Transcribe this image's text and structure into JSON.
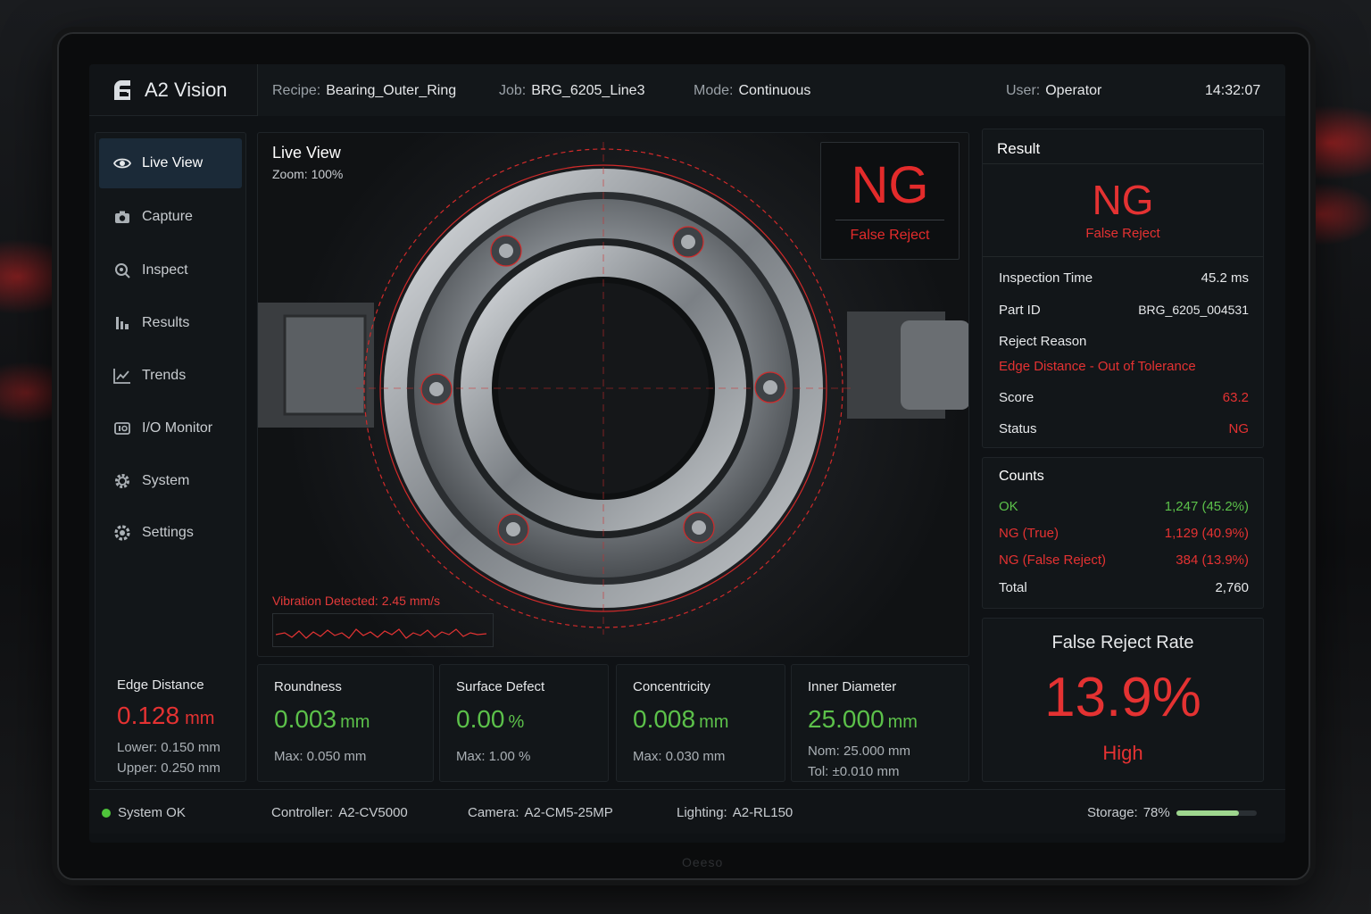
{
  "app": {
    "name": "A2 Vision",
    "bezel_brand": "Oeeso"
  },
  "header": {
    "recipe": {
      "label": "Recipe:",
      "value": "Bearing_Outer_Ring"
    },
    "job": {
      "label": "Job:",
      "value": "BRG_6205_Line3"
    },
    "mode": {
      "label": "Mode:",
      "value": "Continuous"
    },
    "user": {
      "label": "User:",
      "value": "Operator"
    },
    "time": "14:32:07"
  },
  "sidebar": {
    "items": [
      {
        "label": "Live View",
        "icon": "eye-icon",
        "active": true
      },
      {
        "label": "Capture",
        "icon": "camera-icon"
      },
      {
        "label": "Inspect",
        "icon": "magnifier-icon"
      },
      {
        "label": "Results",
        "icon": "results-icon"
      },
      {
        "label": "Trends",
        "icon": "trend-icon"
      },
      {
        "label": "I/O Monitor",
        "icon": "io-icon"
      },
      {
        "label": "System",
        "icon": "system-gear-icon"
      },
      {
        "label": "Settings",
        "icon": "settings-gear-icon"
      }
    ]
  },
  "live_view": {
    "title": "Live View",
    "zoom": "Zoom: 100%",
    "result": "NG",
    "result_sub": "False Reject",
    "vibration": "Vibration Detected: 2.45 mm/s"
  },
  "metrics": {
    "edge_distance": {
      "title": "Edge Distance",
      "value": "0.128",
      "unit": "mm",
      "sub1": "Lower: 0.150 mm",
      "sub2": "Upper: 0.250 mm"
    },
    "roundness": {
      "title": "Roundness",
      "value": "0.003",
      "unit": "mm",
      "sub1": "Max: 0.050 mm"
    },
    "surface_defect": {
      "title": "Surface Defect",
      "value": "0.00",
      "unit": "%",
      "sub1": "Max: 1.00 %"
    },
    "concentricity": {
      "title": "Concentricity",
      "value": "0.008",
      "unit": "mm",
      "sub1": "Max: 0.030 mm"
    },
    "inner_diameter": {
      "title": "Inner Diameter",
      "value": "25.000",
      "unit": "mm",
      "sub1": "Nom: 25.000 mm",
      "sub2": "Tol: ±0.010 mm"
    }
  },
  "result": {
    "title": "Result",
    "big": "NG",
    "sub": "False Reject",
    "inspection_time": {
      "label": "Inspection Time",
      "value": "45.2 ms"
    },
    "part_id": {
      "label": "Part ID",
      "value": "BRG_6205_004531"
    },
    "reject_reason": {
      "label": "Reject Reason",
      "value": "Edge Distance - Out of Tolerance"
    },
    "score": {
      "label": "Score",
      "value": "63.2"
    },
    "status": {
      "label": "Status",
      "value": "NG"
    }
  },
  "counts": {
    "title": "Counts",
    "ok": {
      "label": "OK",
      "value": "1,247 (45.2%)"
    },
    "ng_true": {
      "label": "NG (True)",
      "value": "1,129 (40.9%)"
    },
    "ng_false": {
      "label": "NG (False Reject)",
      "value": "384 (13.9%)"
    },
    "total": {
      "label": "Total",
      "value": "2,760"
    }
  },
  "false_reject_rate": {
    "title": "False Reject Rate",
    "value": "13.9%",
    "level": "High"
  },
  "status_bar": {
    "system": "System OK",
    "controller": {
      "label": "Controller:",
      "value": "A2-CV5000"
    },
    "camera": {
      "label": "Camera:",
      "value": "A2-CM5-25MP"
    },
    "lighting": {
      "label": "Lighting:",
      "value": "A2-RL150"
    },
    "storage": {
      "label": "Storage:",
      "value": "78%"
    },
    "storage_fraction": 0.78
  },
  "colors": {
    "ok": "#5cc14a",
    "ng": "#e43232",
    "accent_nav": "#1b2a38"
  }
}
